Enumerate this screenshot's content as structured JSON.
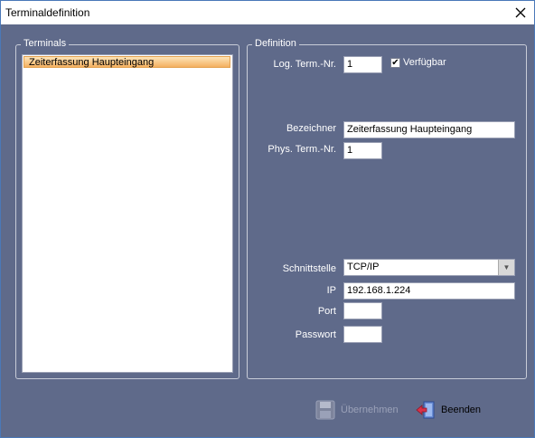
{
  "window": {
    "title": "Terminaldefinition"
  },
  "terminals": {
    "legend": "Terminals",
    "items": [
      "Zeiterfassung Haupteingang"
    ]
  },
  "definition": {
    "legend": "Definition",
    "log_term_nr": {
      "label": "Log. Term.-Nr.",
      "value": "1"
    },
    "available": {
      "label": "Verfügbar",
      "checked": true
    },
    "name": {
      "label": "Bezeichner",
      "value": "Zeiterfassung Haupteingang"
    },
    "phys_term_nr": {
      "label": "Phys. Term.-Nr.",
      "value": "1"
    },
    "interface": {
      "label": "Schnittstelle",
      "value": "TCP/IP"
    },
    "ip": {
      "label": "IP",
      "value": "192.168.1.224"
    },
    "port": {
      "label": "Port",
      "value": ""
    },
    "password": {
      "label": "Passwort",
      "value": ""
    }
  },
  "buttons": {
    "apply": {
      "label": "Übernehmen",
      "icon": "floppy-disk-icon"
    },
    "quit": {
      "label": "Beenden",
      "icon": "exit-door-icon"
    }
  },
  "colors": {
    "background": "#5f6a8a",
    "selection": "#f4b060"
  }
}
